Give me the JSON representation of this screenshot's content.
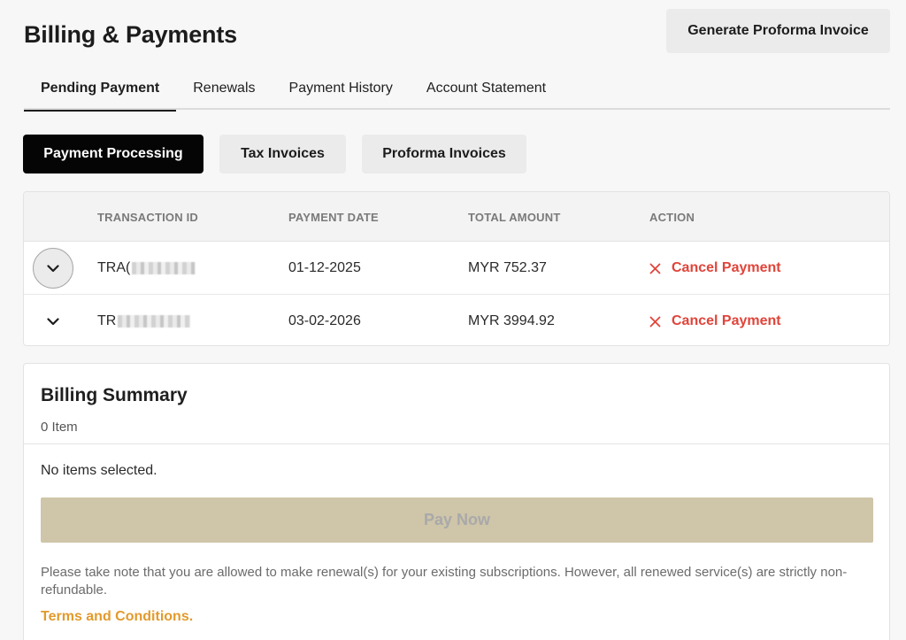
{
  "header": {
    "title": "Billing & Payments",
    "generate_button": "Generate Proforma Invoice"
  },
  "tabs": [
    {
      "label": "Pending Payment",
      "active": true
    },
    {
      "label": "Renewals",
      "active": false
    },
    {
      "label": "Payment History",
      "active": false
    },
    {
      "label": "Account Statement",
      "active": false
    }
  ],
  "subtabs": [
    {
      "label": "Payment Processing",
      "active": true
    },
    {
      "label": "Tax Invoices",
      "active": false
    },
    {
      "label": "Proforma Invoices",
      "active": false
    }
  ],
  "table": {
    "columns": {
      "transaction_id": "TRANSACTION ID",
      "payment_date": "PAYMENT DATE",
      "total_amount": "TOTAL AMOUNT",
      "action": "ACTION"
    },
    "rows": [
      {
        "transaction_prefix": "TRA(",
        "payment_date": "01-12-2025",
        "total_amount": "MYR 752.37",
        "action": "Cancel Payment"
      },
      {
        "transaction_prefix": "TR",
        "payment_date": "03-02-2026",
        "total_amount": "MYR 3994.92",
        "action": "Cancel Payment"
      }
    ]
  },
  "summary": {
    "title": "Billing Summary",
    "count": "0 Item",
    "empty_text": "No items selected.",
    "pay_button": "Pay Now",
    "note": "Please take note that you are allowed to make renewal(s) for your existing subscriptions. However, all renewed service(s) are strictly non-refundable.",
    "terms_link": "Terms and Conditions."
  },
  "colors": {
    "accent_black": "#050505",
    "cancel_red": "#e0443a",
    "terms_orange": "#e29a2c",
    "pay_disabled": "#cfc5a9"
  },
  "icons": {
    "expand": "chevron-down-icon",
    "cancel": "close-icon"
  }
}
